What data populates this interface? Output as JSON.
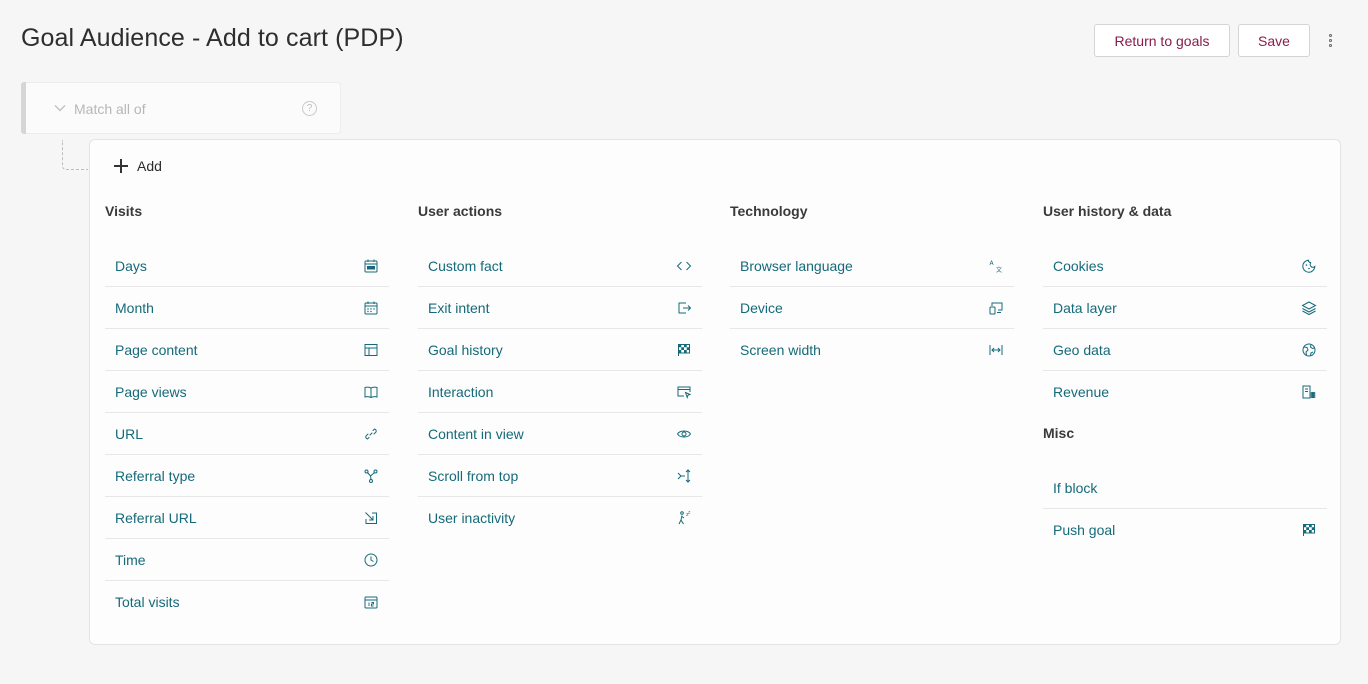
{
  "header": {
    "title": "Goal Audience - Add to cart (PDP)",
    "return_label": "Return to goals",
    "save_label": "Save"
  },
  "match": {
    "label": "Match all of",
    "help": "?"
  },
  "panel": {
    "add_label": "Add",
    "columns": [
      {
        "title": "Visits",
        "items": [
          {
            "label": "Days",
            "icon": "calendar-day-icon"
          },
          {
            "label": "Month",
            "icon": "calendar-icon"
          },
          {
            "label": "Page content",
            "icon": "layout-icon"
          },
          {
            "label": "Page views",
            "icon": "book-icon"
          },
          {
            "label": "URL",
            "icon": "link-icon"
          },
          {
            "label": "Referral type",
            "icon": "network-icon"
          },
          {
            "label": "Referral URL",
            "icon": "arrow-in-icon"
          },
          {
            "label": "Time",
            "icon": "clock-icon"
          },
          {
            "label": "Total visits",
            "icon": "calendar-12-icon"
          }
        ]
      },
      {
        "title": "User actions",
        "items": [
          {
            "label": "Custom fact",
            "icon": "code-icon"
          },
          {
            "label": "Exit intent",
            "icon": "exit-icon"
          },
          {
            "label": "Goal history",
            "icon": "flag-icon"
          },
          {
            "label": "Interaction",
            "icon": "cursor-window-icon"
          },
          {
            "label": "Content in view",
            "icon": "eye-icon"
          },
          {
            "label": "Scroll from top",
            "icon": "scroll-icon"
          },
          {
            "label": "User inactivity",
            "icon": "inactivity-icon"
          }
        ]
      },
      {
        "title": "Technology",
        "items": [
          {
            "label": "Browser language",
            "icon": "translate-icon"
          },
          {
            "label": "Device",
            "icon": "devices-icon"
          },
          {
            "label": "Screen width",
            "icon": "width-icon"
          }
        ]
      },
      {
        "title": "User history & data",
        "items": [
          {
            "label": "Cookies",
            "icon": "cookie-icon"
          },
          {
            "label": "Data layer",
            "icon": "layers-icon"
          },
          {
            "label": "Geo data",
            "icon": "globe-icon"
          },
          {
            "label": "Revenue",
            "icon": "revenue-icon"
          }
        ],
        "sub_title": "Misc",
        "sub_items": [
          {
            "label": "If block",
            "icon": ""
          },
          {
            "label": "Push goal",
            "icon": "flag-icon"
          }
        ]
      }
    ]
  },
  "colors": {
    "accent_text": "#156a79",
    "button_text": "#8a1c4a",
    "background": "#f6f6f7"
  }
}
